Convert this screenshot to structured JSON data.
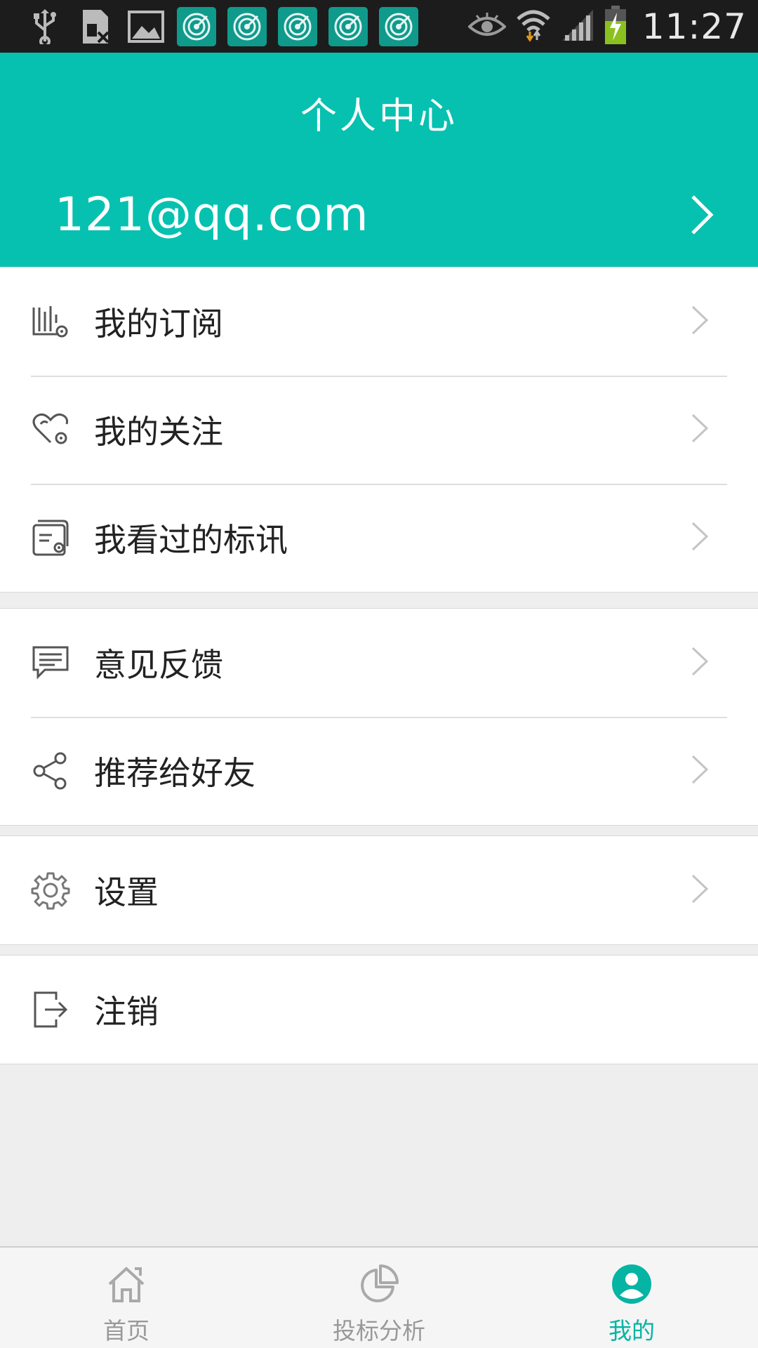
{
  "status_bar": {
    "time": "11:27",
    "left_icons": [
      "usb-icon",
      "sim-card-icon",
      "image-icon"
    ],
    "app_notifications": [
      "target-app-icon",
      "target-app-icon",
      "target-app-icon",
      "target-app-icon",
      "target-app-icon"
    ],
    "right_icons": [
      "eye-icon",
      "wifi-icon",
      "signal-icon",
      "battery-charging-icon"
    ]
  },
  "header": {
    "title": "个人中心",
    "account_email": "121@qq.com"
  },
  "menu": {
    "group1": [
      {
        "label": "我的订阅",
        "icon": "subscription-icon"
      },
      {
        "label": "我的关注",
        "icon": "heart-settings-icon"
      },
      {
        "label": "我看过的标讯",
        "icon": "history-icon"
      }
    ],
    "group2": [
      {
        "label": "意见反馈",
        "icon": "feedback-icon"
      },
      {
        "label": "推荐给好友",
        "icon": "share-icon"
      }
    ],
    "group3": [
      {
        "label": "设置",
        "icon": "gear-icon"
      }
    ],
    "group4": [
      {
        "label": "注销",
        "icon": "logout-icon"
      }
    ]
  },
  "tabs": [
    {
      "label": "首页",
      "icon": "home-icon",
      "active": false
    },
    {
      "label": "投标分析",
      "icon": "pie-chart-icon",
      "active": false
    },
    {
      "label": "我的",
      "icon": "user-icon",
      "active": true
    }
  ],
  "colors": {
    "accent": "#06c1b0",
    "active_tab": "#06b4a4",
    "inactive_tab": "#999999",
    "background": "#eeeeee"
  }
}
